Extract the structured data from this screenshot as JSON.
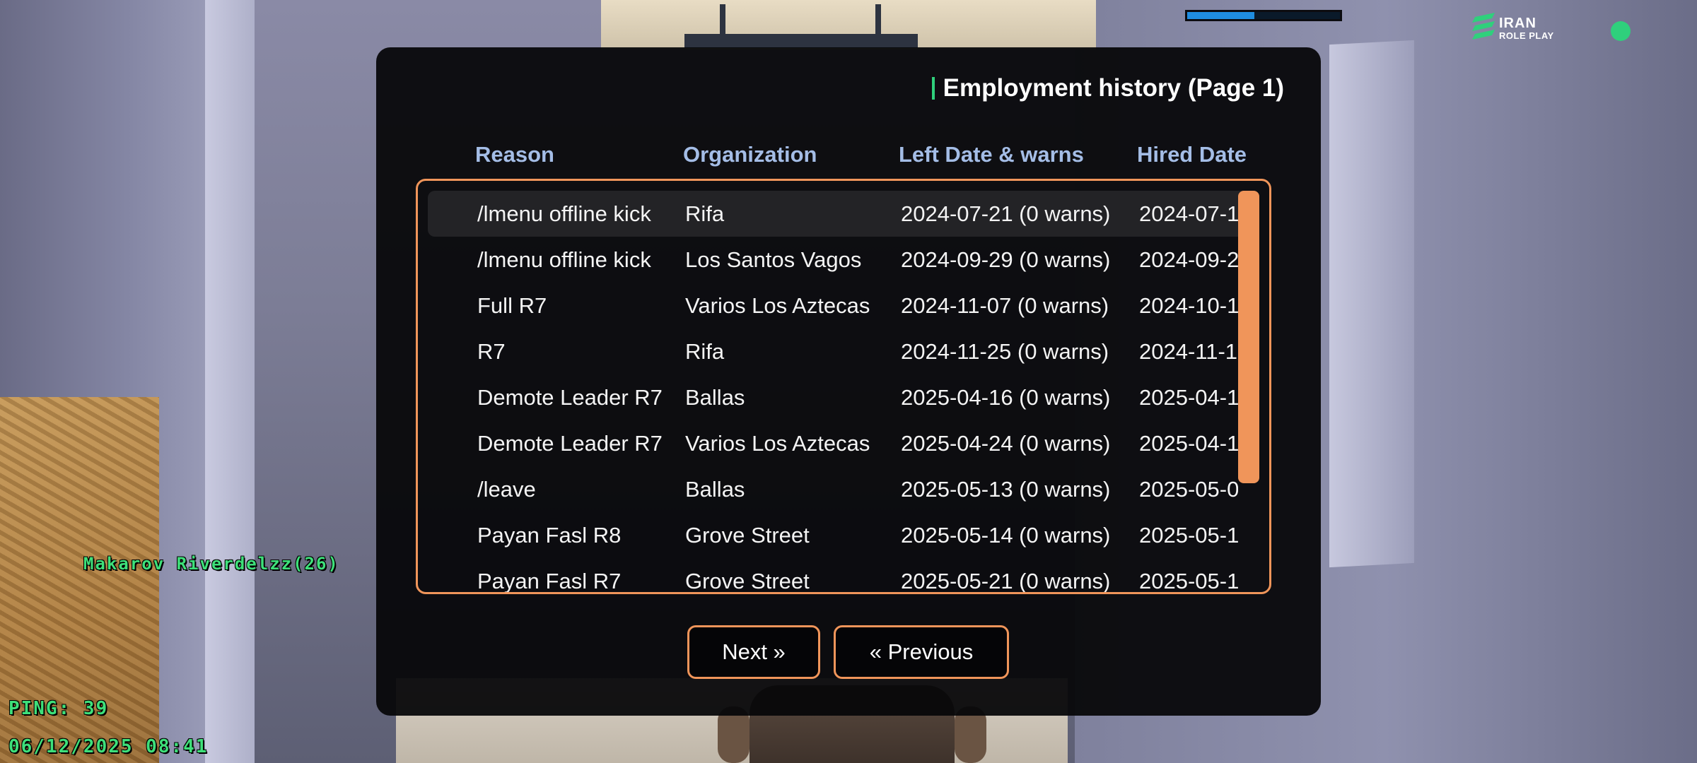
{
  "hud": {
    "health_fraction": 0.44,
    "logo_top": "IRAN",
    "logo_bottom": "ROLE PLAY",
    "player_nametag": "Makarov Riverdelzz(26)",
    "ping": "PING: 39",
    "datetime": "06/12/2025 08:41",
    "status_color": "#2fd07c"
  },
  "dialog": {
    "title": "Employment history (Page 1)",
    "accent_color": "#2fd07c",
    "border_color": "#f0955a",
    "columns": [
      "Reason",
      "Organization",
      "Left Date & warns",
      "Hired Date"
    ],
    "rows": [
      {
        "reason": "/lmenu offline kick",
        "organization": "Rifa",
        "left": "2024-07-21 (0 warns)",
        "hired": "2024-07-1",
        "selected": true
      },
      {
        "reason": "/lmenu offline kick",
        "organization": "Los Santos Vagos",
        "left": "2024-09-29 (0 warns)",
        "hired": "2024-09-2"
      },
      {
        "reason": "Full R7",
        "organization": "Varios Los Aztecas",
        "left": "2024-11-07 (0 warns)",
        "hired": "2024-10-1"
      },
      {
        "reason": "R7",
        "organization": "Rifa",
        "left": "2024-11-25 (0 warns)",
        "hired": "2024-11-1"
      },
      {
        "reason": "Demote Leader R7",
        "organization": "Ballas",
        "left": "2025-04-16 (0 warns)",
        "hired": "2025-04-1"
      },
      {
        "reason": "Demote Leader R7",
        "organization": "Varios Los Aztecas",
        "left": "2025-04-24 (0 warns)",
        "hired": "2025-04-1"
      },
      {
        "reason": "/leave",
        "organization": "Ballas",
        "left": "2025-05-13 (0 warns)",
        "hired": "2025-05-0"
      },
      {
        "reason": "Payan Fasl R8",
        "organization": "Grove Street",
        "left": "2025-05-14 (0 warns)",
        "hired": "2025-05-1"
      },
      {
        "reason": "Payan Fasl R7",
        "organization": "Grove Street",
        "left": "2025-05-21 (0 warns)",
        "hired": "2025-05-1"
      }
    ],
    "next_label": "Next »",
    "previous_label": "« Previous"
  }
}
